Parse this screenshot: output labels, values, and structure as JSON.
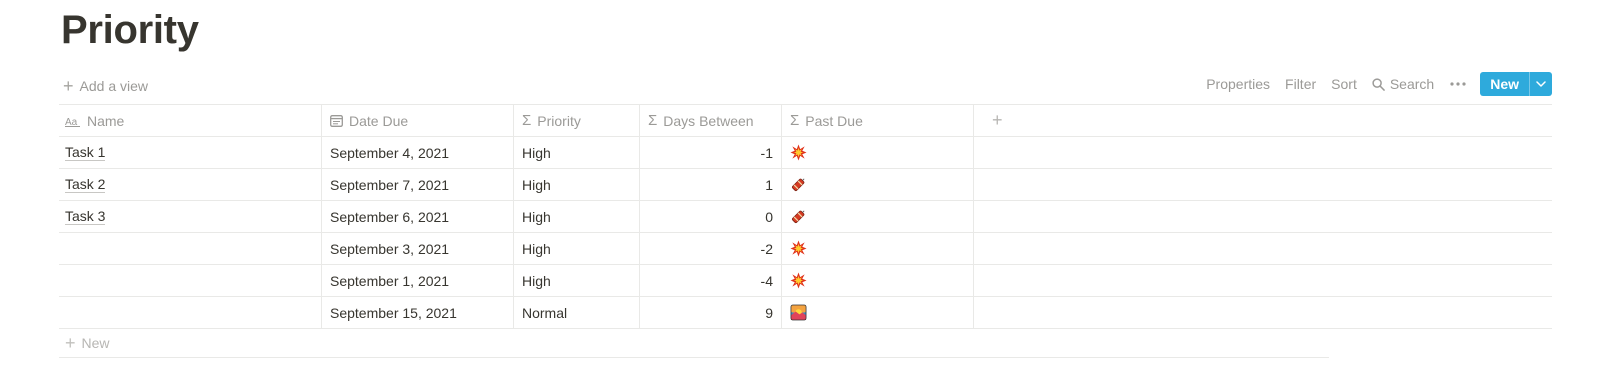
{
  "page": {
    "title": "Priority"
  },
  "toolbar": {
    "add_view_label": "Add a view",
    "properties_label": "Properties",
    "filter_label": "Filter",
    "sort_label": "Sort",
    "search_label": "Search",
    "new_label": "New",
    "accent_color": "#2eaadc"
  },
  "table": {
    "columns": [
      {
        "label": "Name",
        "icon": "text-property-icon"
      },
      {
        "label": "Date Due",
        "icon": "calendar-icon"
      },
      {
        "label": "Priority",
        "icon": "sigma-formula-icon"
      },
      {
        "label": "Days Between",
        "icon": "sigma-formula-icon"
      },
      {
        "label": "Past Due",
        "icon": "sigma-formula-icon"
      }
    ],
    "rows": [
      {
        "name": "Task 1",
        "date_due": "September 4, 2021",
        "priority": "High",
        "days_between": "-1",
        "past_due": "collision-emoji"
      },
      {
        "name": "Task 2",
        "date_due": "September 7, 2021",
        "priority": "High",
        "days_between": "1",
        "past_due": "firecracker-emoji"
      },
      {
        "name": "Task 3",
        "date_due": "September 6, 2021",
        "priority": "High",
        "days_between": "0",
        "past_due": "firecracker-emoji"
      },
      {
        "name": "",
        "date_due": "September 3, 2021",
        "priority": "High",
        "days_between": "-2",
        "past_due": "collision-emoji"
      },
      {
        "name": "",
        "date_due": "September 1, 2021",
        "priority": "High",
        "days_between": "-4",
        "past_due": "collision-emoji"
      },
      {
        "name": "",
        "date_due": "September 15, 2021",
        "priority": "Normal",
        "days_between": "9",
        "past_due": "sunrise-picture-emoji"
      }
    ],
    "new_row_label": "New"
  }
}
